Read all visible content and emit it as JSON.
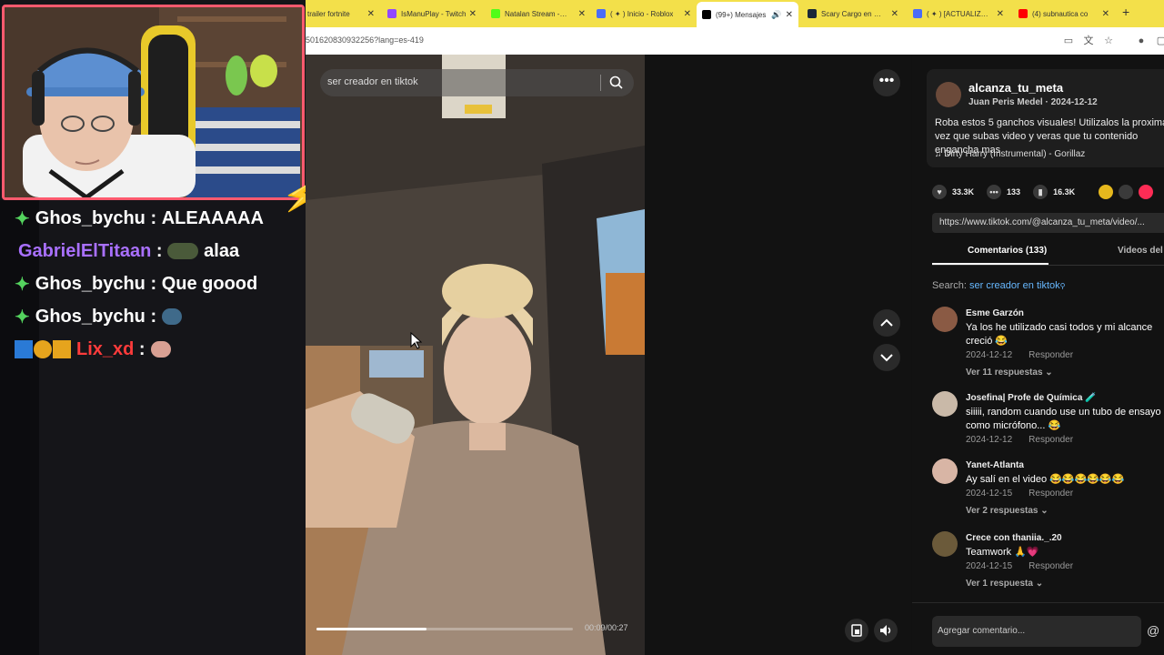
{
  "browser": {
    "tabs": [
      {
        "label": "trailer fortnite",
        "color": "#e03030"
      },
      {
        "label": "IsManuPlay - Twitch",
        "color": "#9147ff"
      },
      {
        "label": "Natalan Stream - Kick",
        "color": "#53fc18"
      },
      {
        "label": "( ✦ ) Inicio - Roblox",
        "color": "#4a6cf7"
      },
      {
        "label": "(99+) Mensajes",
        "color": "#000000"
      },
      {
        "label": "Scary Cargo en Steam",
        "color": "#1b2838"
      },
      {
        "label": "( ✦ ) [ACTUALIZACIÓN]",
        "color": "#4a6cf7"
      },
      {
        "label": "(4) subnautica co",
        "color": "#ff0000"
      }
    ],
    "url": "501620830932256?lang=es-419"
  },
  "chat": [
    {
      "user": "Ghos_bychu",
      "text": "ALEAAAAA",
      "user_color": "#ffffff"
    },
    {
      "user": "GabrielElTitaan",
      "text": "alaa",
      "user_color": "#a970ff"
    },
    {
      "user": "Ghos_bychu",
      "text": "Que goood",
      "user_color": "#ffffff"
    },
    {
      "user": "Ghos_bychu",
      "text": "",
      "user_color": "#ffffff"
    },
    {
      "user": "Lix_xd",
      "text": "",
      "user_color": "#ff3b3b"
    }
  ],
  "video": {
    "search_text": "ser creador en tiktok",
    "timecode": "00:09/00:27",
    "progress": 0.43
  },
  "post": {
    "author": "alcanza_tu_meta",
    "sub": "Juan Peris Medel · 2024-12-12",
    "description": "Roba estos 5 ganchos visuales! Utilizalos la proxima vez que subas video y veras que tu contenido engancha mas",
    "music": "Dirty Harry (Instrumental) - Gorillaz",
    "likes": "33.3K",
    "comments": "133",
    "saves": "16.3K",
    "link": "https://www.tiktok.com/@alcanza_tu_meta/video/..."
  },
  "comments_panel": {
    "tab_comments": "Comentarios (133)",
    "tab_videos": "Videos del",
    "search_label": "Search:",
    "search_term": "ser creador en tiktok",
    "reply_label": "Responder",
    "add_placeholder": "Agregar comentario..."
  },
  "comment_list": [
    {
      "user": "Esme Garzón",
      "text": "Ya los he utilizado casi todos y mi alcance creció 😂",
      "date": "2024-12-12",
      "replies": "Ver 11 respuestas ⌄",
      "avatar_color": "#8a5a44"
    },
    {
      "user": "Josefina| Profe de Química 🧪",
      "text": "siiiii, random cuando use un tubo de ensayo como micrófono... 😂",
      "date": "2024-12-12",
      "replies": "",
      "avatar_color": "#c9b9a8"
    },
    {
      "user": "Yanet-Atlanta",
      "text": "Ay salí en el video 😂😂😂😂😂😂",
      "date": "2024-12-15",
      "replies": "Ver 2 respuestas ⌄",
      "avatar_color": "#d8b5a5"
    },
    {
      "user": "Crece con thaniia._.20",
      "text": "Teamwork 🙏💗",
      "date": "2024-12-15",
      "replies": "Ver 1 respuesta ⌄",
      "avatar_color": "#6b5a3a"
    }
  ]
}
